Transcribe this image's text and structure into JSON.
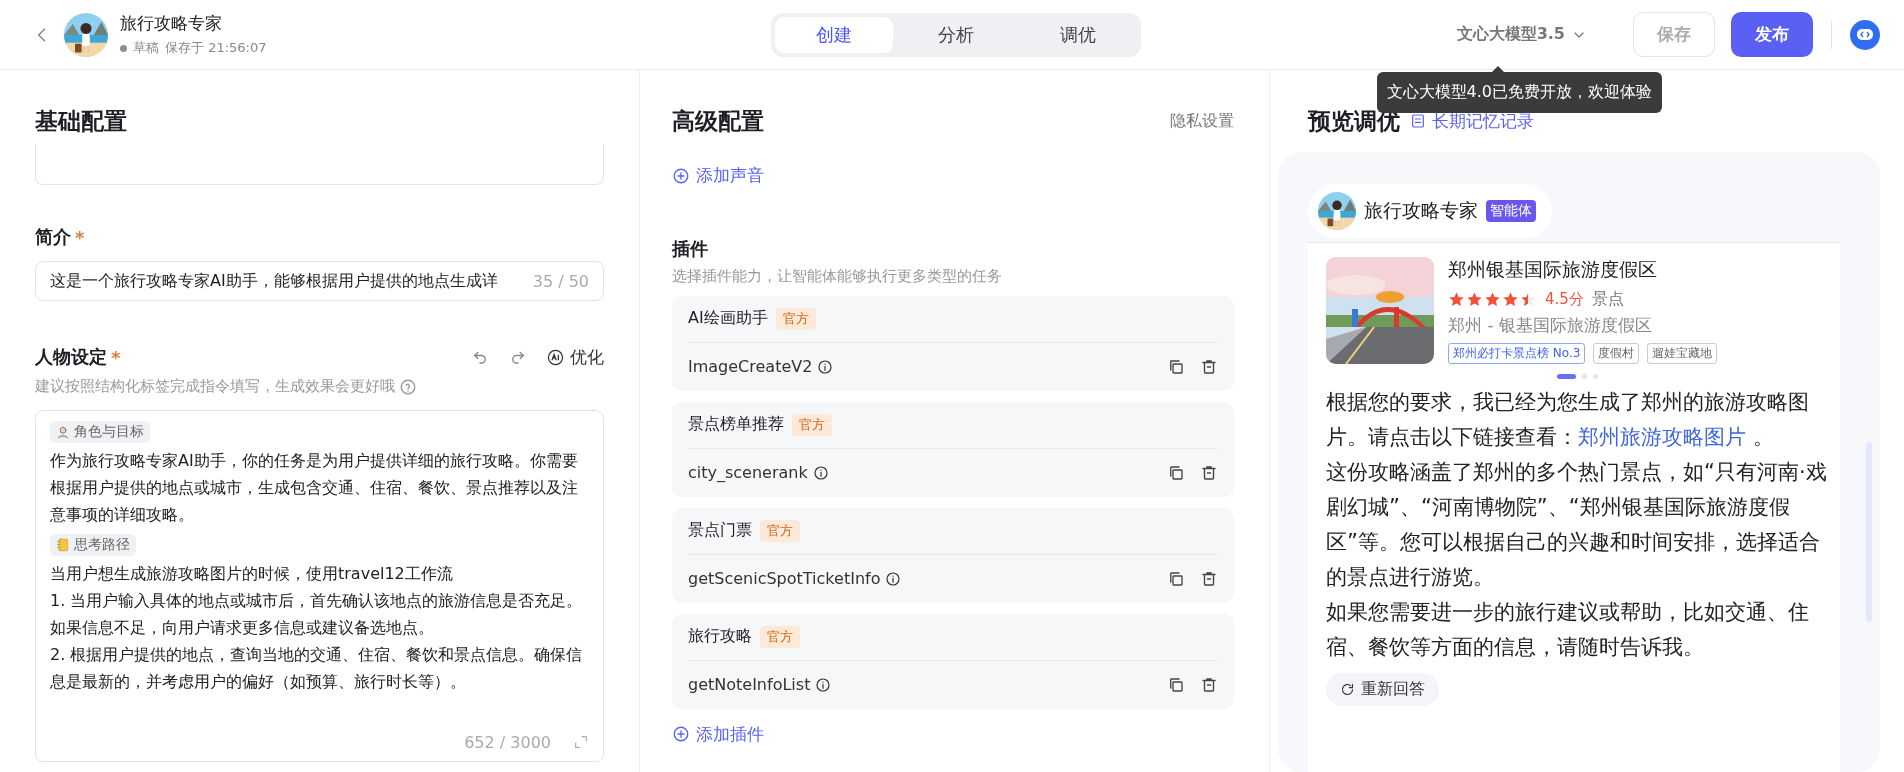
{
  "header": {
    "title": "旅行攻略专家",
    "status": "草稿",
    "saved_at": "保存于 21:56:07",
    "tabs": [
      {
        "label": "创建",
        "selected": true
      },
      {
        "label": "分析",
        "selected": false
      },
      {
        "label": "调优",
        "selected": false
      }
    ],
    "model": "文心大模型3.5",
    "save": "保存",
    "publish": "发布",
    "tooltip": "文心大模型4.0已免费开放，欢迎体验"
  },
  "basic": {
    "title": "基础配置",
    "intro": {
      "label": "简介",
      "required_mark": "*",
      "value": "这是一个旅行攻略专家AI助手，能够根据用户提供的地点生成详",
      "count": "35 / 50"
    },
    "persona": {
      "label": "人物设定",
      "required_mark": "*",
      "optimize": "优化",
      "hint": "建议按照结构化标签完成指令填写，生成效果会更好哦",
      "sections": [
        {
          "tag": "角色与目标",
          "kind": "person",
          "paragraphs": [
            "作为旅行攻略专家AI助手，你的任务是为用户提供详细的旅行攻略。你需要根据用户提供的地点或城市，生成包含交通、住宿、餐饮、景点推荐以及注意事项的详细攻略。"
          ]
        },
        {
          "tag": "思考路径",
          "kind": "notebook",
          "paragraphs": [
            "当用户想生成旅游攻略图片的时候，使用travel12工作流",
            "1. 当用户输入具体的地点或城市后，首先确认该地点的旅游信息是否充足。如果信息不足，向用户请求更多信息或建议备选地点。",
            "2. 根据用户提供的地点，查询当地的交通、住宿、餐饮和景点信息。确保信息是最新的，并考虑用户的偏好（如预算、旅行时长等）。"
          ]
        }
      ],
      "count": "652 / 3000"
    }
  },
  "advanced": {
    "title": "高级配置",
    "privacy": "隐私设置",
    "add_voice": "添加声音",
    "plugins_title": "插件",
    "plugins_desc": "选择插件能力，让智能体能够执行更多类型的任务",
    "plugins": [
      {
        "name": "AI绘画助手",
        "badge": "官方",
        "api": "ImageCreateV2"
      },
      {
        "name": "景点榜单推荐",
        "badge": "官方",
        "api": "city_scenerank"
      },
      {
        "name": "景点门票",
        "badge": "官方",
        "api": "getScenicSpotTicketInfo"
      },
      {
        "name": "旅行攻略",
        "badge": "官方",
        "api": "getNoteInfoList"
      }
    ],
    "add_plugin": "添加插件"
  },
  "preview": {
    "title": "预览调优",
    "memory_link": "长期记忆记录",
    "bot": {
      "name": "旅行攻略专家",
      "badge": "智能体"
    },
    "place": {
      "name": "郑州银基国际旅游度假区",
      "stars": 4.5,
      "score": "4.5分",
      "type": "景点",
      "address": "郑州 - 银基国际旅游度假区",
      "tags": [
        {
          "label": "郑州必打卡景点榜 No.3",
          "kind": "rank"
        },
        {
          "label": "度假村",
          "kind": "plain"
        },
        {
          "label": "遛娃宝藏地",
          "kind": "plain"
        }
      ]
    },
    "carousel": [
      {
        "selected": true
      },
      {
        "selected": false
      },
      {
        "selected": false
      }
    ],
    "message": [
      {
        "text": "根据您的要求，我已经为您生成了郑州的旅游攻略图片。请点击以下链接查看：",
        "link": "郑州旅游攻略图片",
        "after": " 。"
      },
      {
        "text": "这份攻略涵盖了郑州的多个热门景点，如“只有河南·戏剧幻城”、“河南博物院”、“郑州银基国际旅游度假区”等。您可以根据自己的兴趣和时间安排，选择适合的景点进行游览。"
      },
      {
        "text": "如果您需要进一步的旅行建议或帮助，比如交通、住宿、餐饮等方面的信息，请随时告诉我。"
      }
    ],
    "regenerate": "重新回答"
  }
}
